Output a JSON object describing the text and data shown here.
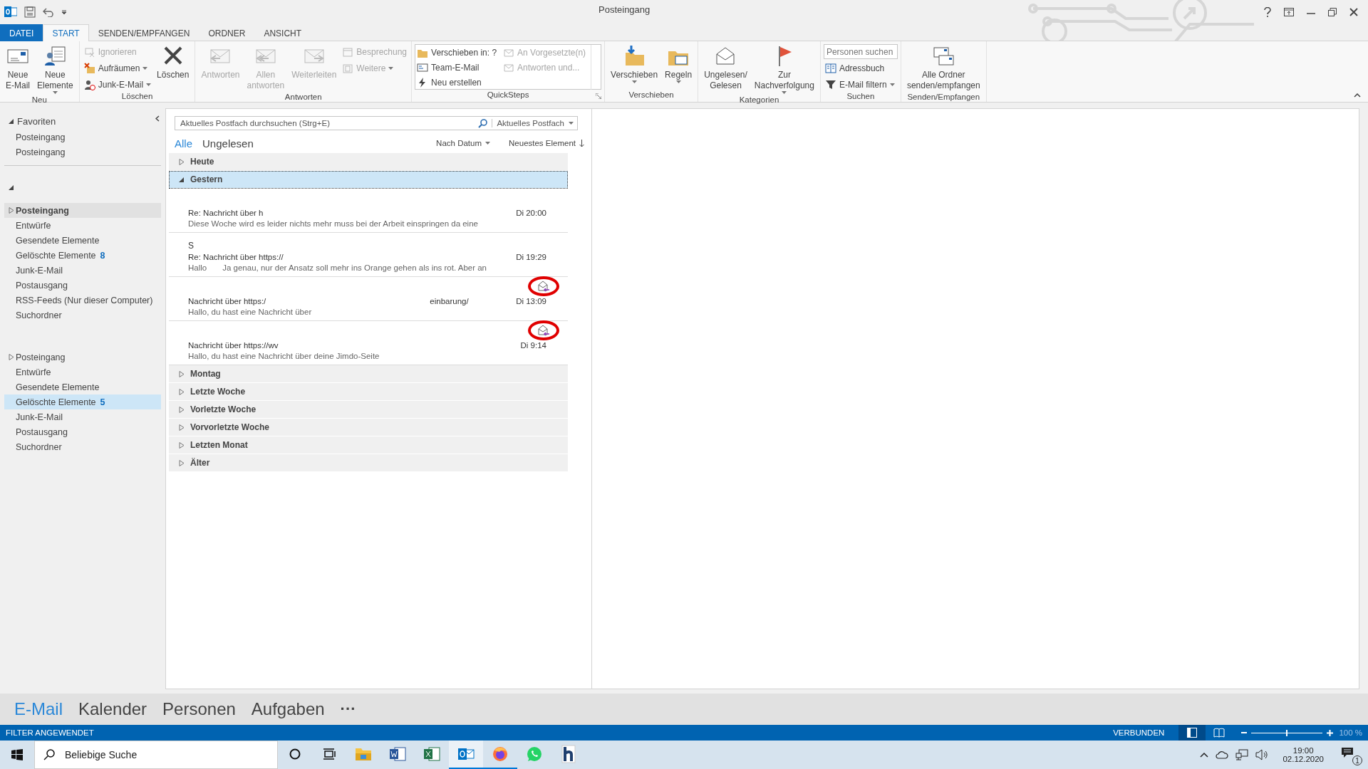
{
  "window": {
    "title": "Posteingang"
  },
  "tabs": [
    {
      "label": "DATEI",
      "kind": "file",
      "selected": false
    },
    {
      "label": "START",
      "kind": "tab",
      "selected": true
    },
    {
      "label": "SENDEN/EMPFANGEN",
      "kind": "tab",
      "selected": false
    },
    {
      "label": "ORDNER",
      "kind": "tab",
      "selected": false
    },
    {
      "label": "ANSICHT",
      "kind": "tab",
      "selected": false
    }
  ],
  "ribbon": {
    "groups": [
      {
        "label": "Neu",
        "columns": [
          {
            "kind": "large",
            "items": [
              {
                "label": "Neue\nE-Mail",
                "disabled": false,
                "dropdown": false
              }
            ]
          },
          {
            "kind": "large",
            "items": [
              {
                "label": "Neue\nElemente",
                "disabled": false,
                "dropdown": true
              }
            ]
          }
        ]
      },
      {
        "label": "Löschen",
        "columns": [
          {
            "kind": "stack",
            "items": [
              {
                "label": "Ignorieren",
                "disabled": true,
                "dropdown": false
              },
              {
                "label": "Aufräumen",
                "disabled": false,
                "dropdown": true
              },
              {
                "label": "Junk-E-Mail",
                "disabled": false,
                "dropdown": true
              }
            ]
          },
          {
            "kind": "large",
            "items": [
              {
                "label": "Löschen",
                "disabled": false,
                "dropdown": false
              }
            ]
          }
        ]
      },
      {
        "label": "Antworten",
        "columns": [
          {
            "kind": "large",
            "items": [
              {
                "label": "Antworten",
                "disabled": true,
                "dropdown": false
              }
            ]
          },
          {
            "kind": "large",
            "items": [
              {
                "label": "Allen\nantworten",
                "disabled": true,
                "dropdown": false
              }
            ]
          },
          {
            "kind": "large",
            "items": [
              {
                "label": "Weiterleiten",
                "disabled": true,
                "dropdown": false
              }
            ]
          },
          {
            "kind": "stack",
            "items": [
              {
                "label": "Besprechung",
                "disabled": true,
                "dropdown": false
              },
              {
                "label": "Weitere",
                "disabled": true,
                "dropdown": true
              }
            ]
          }
        ]
      },
      {
        "label": "QuickSteps",
        "launcher": true,
        "columns": [
          {
            "kind": "gallery",
            "items": [
              {
                "label": "Verschieben in: ?",
                "disabled": false,
                "dropdown": false
              },
              {
                "label": "An Vorgesetzte(n)",
                "disabled": true,
                "dropdown": false
              },
              {
                "label": "Team-E-Mail",
                "disabled": false,
                "dropdown": false
              },
              {
                "label": "Antworten und...",
                "disabled": true,
                "dropdown": false
              },
              {
                "label": "Neu erstellen",
                "disabled": false,
                "dropdown": false
              }
            ]
          }
        ]
      },
      {
        "label": "Verschieben",
        "columns": [
          {
            "kind": "large",
            "items": [
              {
                "label": "Verschieben",
                "disabled": false,
                "dropdown": true
              }
            ]
          },
          {
            "kind": "large",
            "items": [
              {
                "label": "Regeln",
                "disabled": false,
                "dropdown": true
              }
            ]
          }
        ]
      },
      {
        "label": "Kategorien",
        "columns": [
          {
            "kind": "large",
            "items": [
              {
                "label": "Ungelesen/\nGelesen",
                "disabled": false,
                "dropdown": false
              }
            ]
          },
          {
            "kind": "large",
            "items": [
              {
                "label": "Zur\nNachverfolgung",
                "disabled": false,
                "dropdown": true
              }
            ]
          }
        ]
      },
      {
        "label": "Suchen",
        "columns": [
          {
            "kind": "stack",
            "items": [
              {
                "kind": "field",
                "placeholder": "Personen suchen"
              },
              {
                "label": "Adressbuch",
                "disabled": false,
                "dropdown": false
              },
              {
                "label": "E-Mail filtern",
                "disabled": false,
                "dropdown": true
              }
            ]
          }
        ]
      },
      {
        "label": "Senden/Empfangen",
        "columns": [
          {
            "kind": "large",
            "items": [
              {
                "label": "Alle Ordner\nsenden/empfangen",
                "disabled": false,
                "dropdown": false
              }
            ]
          }
        ]
      }
    ]
  },
  "nav": {
    "sections": [
      {
        "title": "Favoriten",
        "expanded": true,
        "items": [
          {
            "label": "Posteingang",
            "selected": false,
            "highlighted": false,
            "bold": false
          },
          {
            "label": "Posteingang",
            "selected": false,
            "highlighted": false,
            "bold": false
          }
        ]
      },
      {
        "expanded": true,
        "items": [
          {
            "label": "Posteingang",
            "selected": false,
            "highlighted": true,
            "bold": true,
            "expandable": true
          },
          {
            "label": "Entwürfe",
            "selected": false,
            "highlighted": false,
            "bold": false
          },
          {
            "label": "Gesendete Elemente",
            "selected": false,
            "highlighted": false,
            "bold": false
          },
          {
            "label": "Gelöschte Elemente",
            "count": "8",
            "selected": false,
            "highlighted": false,
            "bold": false
          },
          {
            "label": "Junk-E-Mail",
            "selected": false,
            "highlighted": false,
            "bold": false
          },
          {
            "label": "Postausgang",
            "selected": false,
            "highlighted": false,
            "bold": false
          },
          {
            "label": "RSS-Feeds (Nur dieser Computer)",
            "selected": false,
            "highlighted": false,
            "bold": false
          },
          {
            "label": "Suchordner",
            "selected": false,
            "highlighted": false,
            "bold": false
          }
        ]
      },
      {
        "items": [
          {
            "label": "Posteingang",
            "selected": false,
            "highlighted": false,
            "bold": false,
            "expandable": true
          },
          {
            "label": "Entwürfe",
            "selected": false,
            "highlighted": false,
            "bold": false
          },
          {
            "label": "Gesendete Elemente",
            "selected": false,
            "highlighted": false,
            "bold": false
          },
          {
            "label": "Gelöschte Elemente",
            "count": "5",
            "selected": true,
            "highlighted": false,
            "bold": false
          },
          {
            "label": "Junk-E-Mail",
            "selected": false,
            "highlighted": false,
            "bold": false
          },
          {
            "label": "Postausgang",
            "selected": false,
            "highlighted": false,
            "bold": false
          },
          {
            "label": "Suchordner",
            "selected": false,
            "highlighted": false,
            "bold": false
          }
        ]
      }
    ]
  },
  "list": {
    "search": {
      "placeholder": "Aktuelles Postfach durchsuchen (Strg+E)",
      "scope": "Aktuelles Postfach"
    },
    "filters": [
      {
        "label": "Alle",
        "selected": true
      },
      {
        "label": "Ungelesen",
        "selected": false
      }
    ],
    "sort": {
      "by": "Nach Datum",
      "order": "Neuestes Element"
    },
    "groups": [
      {
        "label": "Heute",
        "expanded": false,
        "selected": false
      },
      {
        "label": "Gestern",
        "expanded": true,
        "selected": true,
        "messages": [
          {
            "subject": "Re: Nachricht über h",
            "time": "Di 20:00",
            "preview": "Diese Woche wird es leider nichts mehr muss bei der Arbeit einspringen da eine",
            "replied": false,
            "circled": false
          },
          {
            "sender": "S",
            "subject": "Re: Nachricht über https://",
            "time": "Di 19:29",
            "greeting": "Hallo",
            "preview": "Ja genau, nur der Ansatz soll mehr ins Orange gehen als ins rot. Aber an",
            "replied": false,
            "circled": false
          },
          {
            "subject": "Nachricht über https:/",
            "subject_tail": "einbarung/",
            "time": "Di 13:09",
            "preview": "Hallo, du hast eine Nachricht über",
            "replied": true,
            "circled": true
          },
          {
            "subject": "Nachricht über https://wv",
            "time": "Di 9:14",
            "preview": "Hallo, du hast eine Nachricht über deine Jimdo-Seite",
            "replied": true,
            "circled": true
          }
        ]
      },
      {
        "label": "Montag",
        "expanded": false,
        "selected": false
      },
      {
        "label": "Letzte Woche",
        "expanded": false,
        "selected": false
      },
      {
        "label": "Vorletzte Woche",
        "expanded": false,
        "selected": false
      },
      {
        "label": "Vorvorletzte Woche",
        "expanded": false,
        "selected": false
      },
      {
        "label": "Letzten Monat",
        "expanded": false,
        "selected": false
      },
      {
        "label": "Älter",
        "expanded": false,
        "selected": false
      }
    ]
  },
  "bottom_nav": {
    "items": [
      {
        "label": "E-Mail",
        "selected": true
      },
      {
        "label": "Kalender",
        "selected": false
      },
      {
        "label": "Personen",
        "selected": false
      },
      {
        "label": "Aufgaben",
        "selected": false
      }
    ],
    "more": "···"
  },
  "status_bar": {
    "left": "FILTER ANGEWENDET",
    "connection": "VERBUNDEN",
    "views": [
      {
        "kind": "normal",
        "selected": true
      },
      {
        "kind": "reading",
        "selected": false
      }
    ],
    "zoom": {
      "level": 0.5,
      "reading": "100 %"
    }
  },
  "taskbar": {
    "search": {
      "placeholder": "Beliebige Suche"
    },
    "apps": [
      {
        "kind": "explorer",
        "running": false,
        "active": false
      },
      {
        "kind": "word",
        "running": false,
        "active": false
      },
      {
        "kind": "excel",
        "running": false,
        "active": false
      },
      {
        "kind": "outlook",
        "running": true,
        "active": true
      },
      {
        "kind": "firefox",
        "running": true,
        "active": false
      },
      {
        "kind": "whatsapp",
        "running": false,
        "active": false
      },
      {
        "kind": "h",
        "running": false,
        "active": false
      }
    ],
    "time": "19:00",
    "date": "02.12.2020",
    "notifications": "1"
  }
}
